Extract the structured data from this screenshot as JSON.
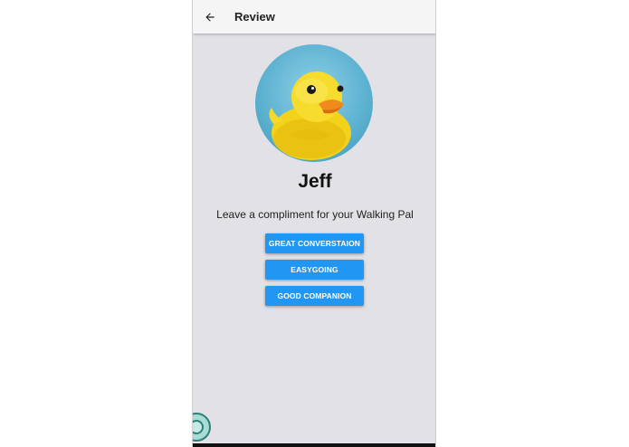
{
  "appbar": {
    "title": "Review",
    "back_icon": "arrow-back-icon"
  },
  "profile": {
    "name": "Jeff",
    "avatar": "rubber-duck-avatar"
  },
  "prompt": "Leave a compliment for your Walking Pal",
  "compliments": [
    {
      "label": "GREAT CONVERSTAION"
    },
    {
      "label": "EASYGOING"
    },
    {
      "label": "GOOD COMPANION"
    }
  ],
  "colors": {
    "background": "#e1e1e6",
    "button": "#2196f3",
    "appbar": "#f5f5f5"
  }
}
